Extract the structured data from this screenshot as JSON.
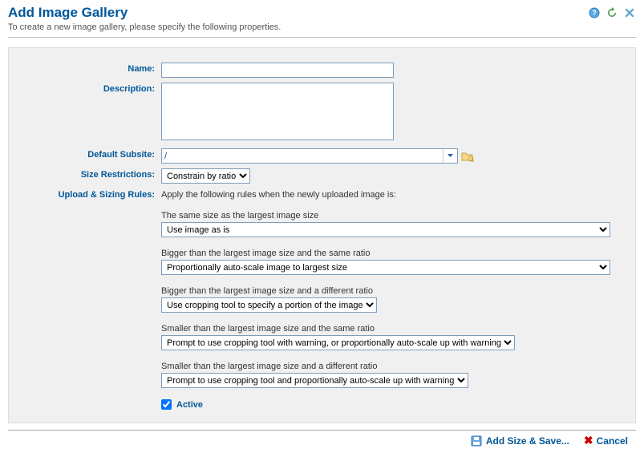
{
  "header": {
    "title": "Add Image Gallery",
    "subtitle": "To create a new image gallery, please specify the following properties."
  },
  "labels": {
    "name": "Name:",
    "description": "Description:",
    "default_subsite": "Default Subsite:",
    "size_restrictions": "Size Restrictions:",
    "upload_rules": "Upload & Sizing Rules:",
    "active": "Active"
  },
  "fields": {
    "name_value": "",
    "description_value": "",
    "default_subsite_value": "/",
    "size_restrictions_value": "Constrain by ratio"
  },
  "rules": {
    "intro": "Apply the following rules when the newly uploaded image is:",
    "r1_label": "The same size as the largest image size",
    "r1_value": "Use image as is",
    "r2_label": "Bigger than the largest image size and the same ratio",
    "r2_value": "Proportionally auto-scale image to largest size",
    "r3_label": "Bigger than the largest image size and a different ratio",
    "r3_value": "Use cropping tool to specify a portion of the image",
    "r4_label": "Smaller than the largest image size and the same ratio",
    "r4_value": "Prompt to use cropping tool with warning, or proportionally auto-scale up with warning",
    "r5_label": "Smaller than the largest image size and a different ratio",
    "r5_value": "Prompt to use cropping tool and proportionally auto-scale up with warning"
  },
  "footer": {
    "add_save": "Add Size & Save...",
    "cancel": "Cancel"
  }
}
